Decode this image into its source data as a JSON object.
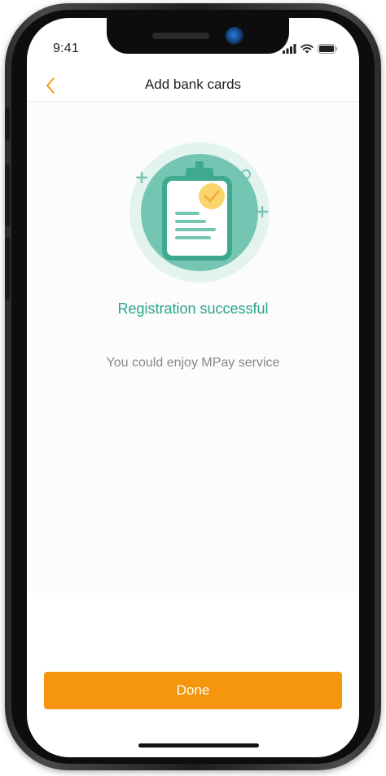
{
  "status_bar": {
    "time": "9:41",
    "icons": [
      "signal-icon",
      "wifi-icon",
      "battery-icon"
    ]
  },
  "nav": {
    "back_icon": "chevron-left-icon",
    "title": "Add bank cards"
  },
  "result": {
    "illustration_icon": "clipboard-check-icon",
    "title": "Registration successful",
    "subtitle": "You could enjoy MPay service"
  },
  "actions": {
    "done_label": "Done"
  },
  "colors": {
    "accent_orange": "#F5960C",
    "success_green": "#2AA48B",
    "illustration_teal": "#74C6B2",
    "check_yellow": "#FAD56B"
  }
}
